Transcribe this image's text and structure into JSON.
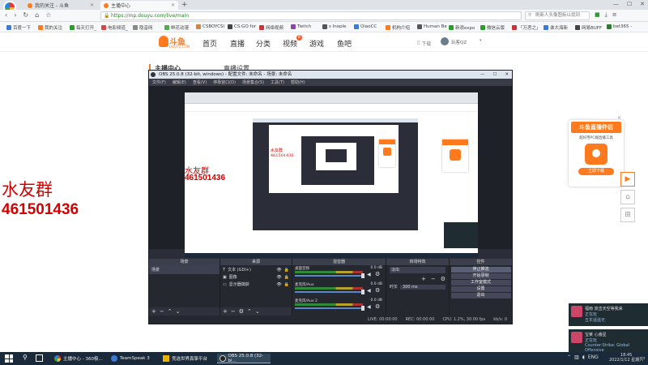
{
  "browser": {
    "tabs": [
      {
        "label": "我的关注 - 斗鱼",
        "active": false
      },
      {
        "label": "主播中心",
        "active": true
      }
    ],
    "url": "https://mp.douyu.com/live/main",
    "search_placeholder": "刷新人头像图标以找到",
    "bookmarks": [
      "百度一下",
      "我的关注",
      "每天打开_",
      "电影频道_",
      "隐音网",
      "鲜花动漫",
      "CSBOYCSI",
      "CS:GO for",
      "网络视频",
      "Twitch",
      "s Inople",
      "QiaoCC",
      "机构介绍",
      "Human Be",
      "新浪expo",
      "微信云版",
      "「万恶之」",
      "谁大海新",
      "网易BUFF",
      "bet365 -"
    ]
  },
  "site": {
    "logo_text": "斗鱼",
    "logo_sub": "DOUYU.COM",
    "nav": [
      "首页",
      "直播",
      "分类",
      "视频",
      "游戏",
      "鱼吧"
    ],
    "nav_badge": "6",
    "download": "下载",
    "username": "玩客QZ",
    "sidebar_heading": "主播中心",
    "page_heading": "直播设置"
  },
  "obs": {
    "title": "OBS 25.0.8 (32-bit, windows) - 配置文件: 未命名 - 场景: 未命名",
    "menu": [
      "文件(F)",
      "编辑(E)",
      "查看(V)",
      "停靠窗口(D)",
      "场景集合(S)",
      "工具(T)",
      "帮助(H)"
    ],
    "docks": {
      "scenes": {
        "title": "场景",
        "items": [
          "场景"
        ]
      },
      "sources": {
        "title": "来源",
        "items": [
          "文本 (GDI+)",
          "图像",
          "显示器捕获"
        ]
      },
      "mixer": {
        "title": "混音器",
        "channels": [
          {
            "name": "桌面音频",
            "db": "0.0 dB"
          },
          {
            "name": "麦克风/Aux",
            "db": "0.0 dB"
          },
          {
            "name": "麦克风/Aux 2",
            "db": "0.0 dB"
          }
        ]
      },
      "transitions": {
        "title": "转场特效",
        "type": "淡出",
        "duration_label": "时长",
        "duration": "300 ms"
      },
      "controls": {
        "title": "控件",
        "buttons": [
          "停止推流",
          "开始录制",
          "工作室模式",
          "设置",
          "退出"
        ]
      }
    },
    "status": {
      "live": "LIVE: 00:00:00",
      "rec": "REC: 00:00:00",
      "cpu": "CPU: 1.2%, 30.00 fps",
      "kbs": "kb/s: 0"
    }
  },
  "overlay": {
    "group_label": "水友群",
    "group_number": "461501436",
    "small_label": "水友群",
    "small_number": "461501436"
  },
  "promo": {
    "title": "斗鱼直播伴侣",
    "subtitle": "超好用PC端直播工具",
    "button": "立即下载"
  },
  "notifications": [
    {
      "line1": "福雨 双击天空等我来",
      "line2": "正在玩",
      "line3": "五年遥遥无"
    },
    {
      "line1": "宝莱 心番星",
      "line2": "正在玩",
      "line3": "Counter-Strike: Global Offensive"
    }
  ],
  "taskbar": {
    "items": [
      "主播中心 - 360极...",
      "TeamSpeak 3",
      "竞选世界真挚平台",
      "OBS 25.0.8 (32-bi..."
    ],
    "lang": "ENG",
    "time": "18:45",
    "date": "2022/1/12 星期六"
  },
  "colors": {
    "accent": "#ff7a1c",
    "overlay_red": "#d40000",
    "obs_bg": "#2b2e38"
  }
}
